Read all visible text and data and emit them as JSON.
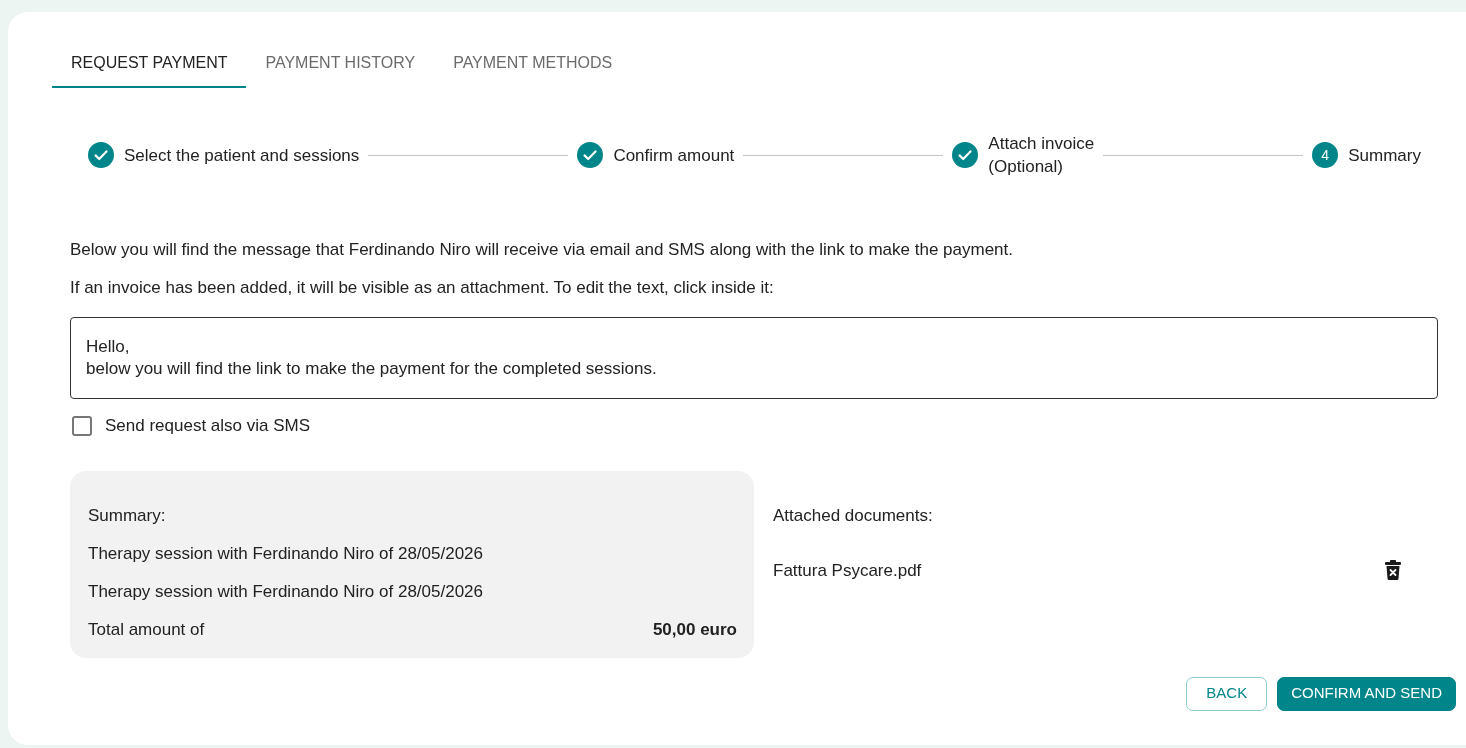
{
  "tabs": [
    {
      "label": "REQUEST PAYMENT",
      "selected": true
    },
    {
      "label": "PAYMENT HISTORY",
      "selected": false
    },
    {
      "label": "PAYMENT METHODS",
      "selected": false
    }
  ],
  "stepper": {
    "steps": [
      {
        "label": "Select the patient and sessions",
        "done": true
      },
      {
        "label": "Confirm amount",
        "done": true
      },
      {
        "label": "Attach invoice",
        "note": "(Optional)",
        "done": true
      },
      {
        "number": "4",
        "label": "Summary",
        "done": false
      }
    ]
  },
  "intro": [
    "Below you will find the message that Ferdinando Niro will receive via email and SMS along with the link to make the payment.",
    "If an invoice has been added, it will be visible as an attachment. To edit the text, click inside it:"
  ],
  "message": {
    "lines": [
      "Hello,",
      "below you will find the link to make the payment for the completed sessions."
    ]
  },
  "sms_option": {
    "label": "Send request also via SMS",
    "checked": false
  },
  "summary": {
    "title": "Summary:",
    "items": [
      "Therapy session with Ferdinando Niro of 28/05/2026",
      "Therapy session with Ferdinando Niro of 28/05/2026"
    ],
    "total_label": "Total amount of",
    "total_value": "50,00 euro"
  },
  "attachments": {
    "title": "Attached documents:",
    "files": [
      {
        "name": "Fattura Psycare.pdf"
      }
    ]
  },
  "buttons": [
    {
      "label": "BACK",
      "kind": "secondary"
    },
    {
      "label": "CONFIRM AND SEND",
      "kind": "primary"
    }
  ]
}
